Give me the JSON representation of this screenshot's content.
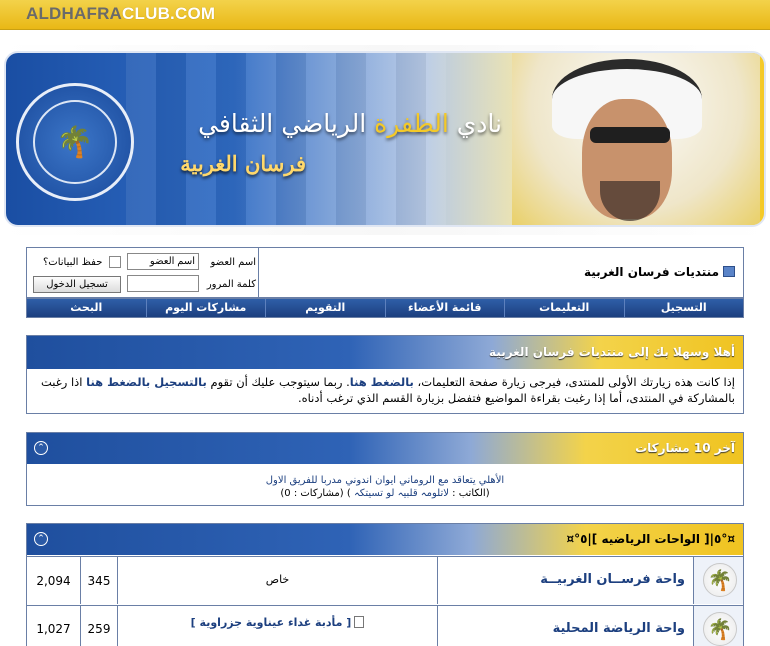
{
  "brand": {
    "prefix": "ALDHAFRA",
    "suffix": "CLUB.COM"
  },
  "banner": {
    "title_pre": "نادي ",
    "title_gold": "الظفرة",
    "title_post": " الرياضي الثقافي",
    "subtitle": "فرسان الغربية"
  },
  "header": {
    "site_title": "منتديات فرسان الغربية",
    "login": {
      "username_label": "اسم العضو",
      "username_value": "اسم العضو",
      "password_label": "كلمة المرور",
      "remember_label": "حفظ البيانات؟",
      "login_button": "تسجيل الدخول"
    }
  },
  "menu": {
    "items": [
      "التسجيل",
      "التعليمات",
      "قائمة الأعضاء",
      "التقويم",
      "مشاركات اليوم",
      "البحث"
    ]
  },
  "welcome": {
    "title": "أهلا وسهلا بك إلى منتديات فرسان الغربية",
    "text_1": "إذا كانت هذه زيارتك الأولى للمنتدى، فيرجى زيارة صفحة التعليمات، ",
    "link_1": "بالضغط هنا",
    "text_2": ". ربما سيتوجب عليك أن تقوم ",
    "link_2": "بالتسجيل بالضغط هنا",
    "text_3": " اذا رغبت بالمشاركة في المنتدى، أما إذا رغبت بقراءة المواضيع فتفضل بزيارة القسم الذي ترغب أدناه."
  },
  "recent": {
    "title": "آخر 10 مشاركات",
    "post_title": "الأهلي يتعاقد مع الروماني ايوان اندوني مدربا للفريق الاول",
    "author_prefix": "(الكاتب : ",
    "author": "لاتلومہ قلبيہ لو تسيتكہ",
    "author_suffix": " )",
    "replies": " (مشاركات : 0)"
  },
  "forum_section": {
    "title": "¤°٥|[ الواحات الرياضيه ]|٥°¤",
    "rows": [
      {
        "name": "واحة فرســان الغربيــة",
        "last_post": "خاص",
        "threads": "345",
        "posts": "2,094"
      },
      {
        "name": "واحة الرياضة المحلية",
        "last_post": "[ مأدبة غداء عيناوية جزراوية ]",
        "threads": "259",
        "posts": "1,027"
      }
    ]
  }
}
